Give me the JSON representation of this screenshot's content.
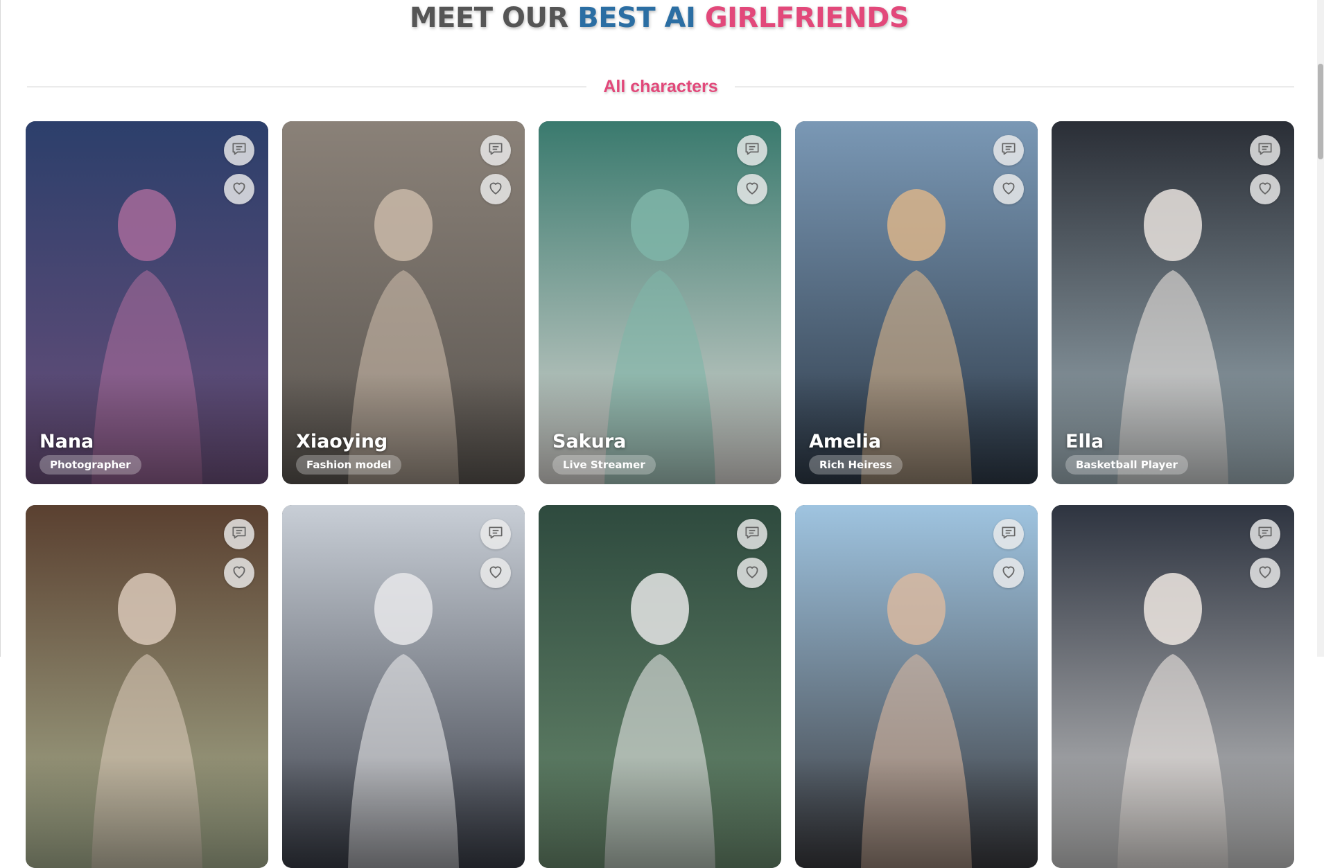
{
  "headline": {
    "part1": "MEET OUR ",
    "part2": "BEST AI ",
    "part3": "GIRLFRIENDS"
  },
  "section": {
    "label": "All characters"
  },
  "colors": {
    "accent_pink": "#e2487a",
    "accent_blue": "#2b6ea3",
    "heading_gray": "#555555"
  },
  "icons": {
    "chat": "chat-bubble-icon",
    "like": "heart-icon"
  },
  "characters": [
    {
      "name": "Nana",
      "role": "Photographer",
      "palette": [
        "#2c3f6b",
        "#6b4f7a",
        "#a66a9a"
      ]
    },
    {
      "name": "Xiaoying",
      "role": "Fashion model",
      "palette": [
        "#8a8178",
        "#5a5550",
        "#c9b9a8"
      ]
    },
    {
      "name": "Sakura",
      "role": "Live Streamer",
      "palette": [
        "#3a7a6e",
        "#d9d6d2",
        "#7fb5a8"
      ]
    },
    {
      "name": "Amelia",
      "role": "Rich Heiress",
      "palette": [
        "#7a98b5",
        "#2e3a48",
        "#d9b48a"
      ]
    },
    {
      "name": "Ella",
      "role": "Basketball Player",
      "palette": [
        "#2a2e36",
        "#9fb0b8",
        "#e9e3de"
      ]
    },
    {
      "name": "",
      "role": "",
      "palette": [
        "#5a4030",
        "#a8b090",
        "#d9c8b8"
      ]
    },
    {
      "name": "",
      "role": "",
      "palette": [
        "#c8ced6",
        "#3a3e48",
        "#e8e8ea"
      ]
    },
    {
      "name": "",
      "role": "",
      "palette": [
        "#2e4a3e",
        "#6a8a6e",
        "#e6e6e6"
      ]
    },
    {
      "name": "",
      "role": "",
      "palette": [
        "#9fc4e0",
        "#3a3a3e",
        "#d8b8a0"
      ]
    },
    {
      "name": "",
      "role": "",
      "palette": [
        "#2e3440",
        "#c8c8c8",
        "#efe8e2"
      ]
    }
  ]
}
